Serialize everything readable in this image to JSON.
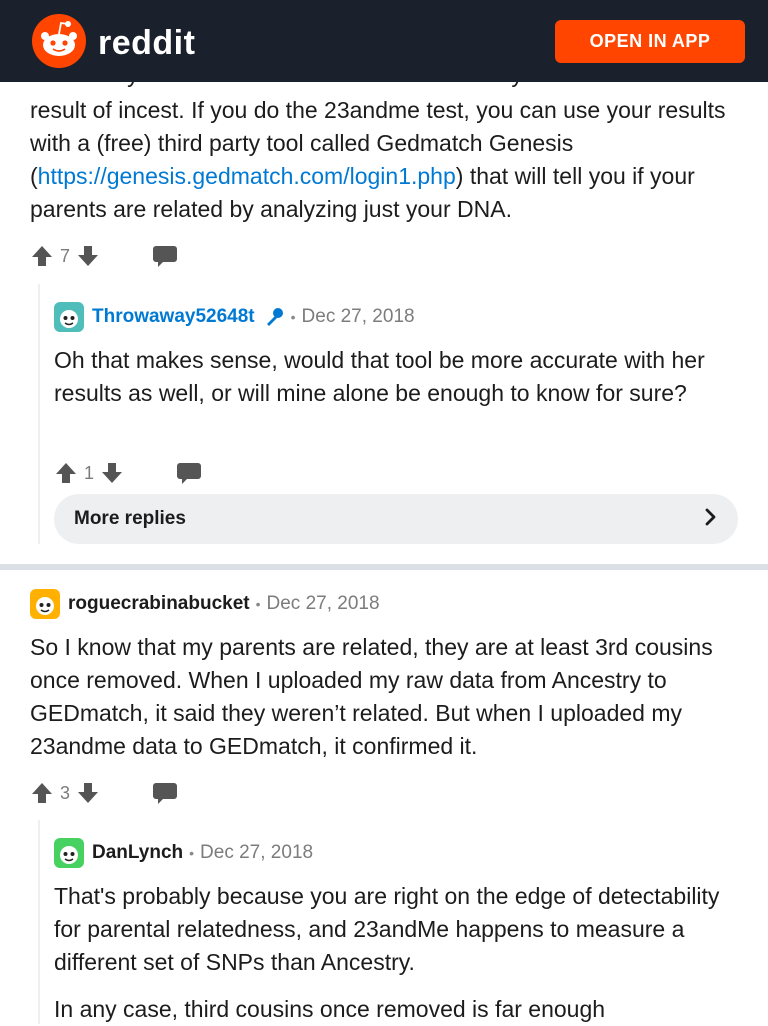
{
  "header": {
    "brand": "reddit",
    "open_app_label": "OPEN IN APP"
  },
  "colors": {
    "brand_orange": "#ff4500",
    "header_bg": "#1a202c",
    "link_blue": "#0079d3",
    "op_blue": "#0079d3"
  },
  "comments": [
    {
      "clipped_top": "However you don't need to do that to find out if you're the",
      "text_before_link": "result of incest. If you do the 23andme test, you can use your results with a (free) third party tool called Gedmatch Genesis (",
      "link": "https://genesis.gedmatch.com/login1.php",
      "text_after_link": ") that will tell you if your parents are related by analyzing just your DNA.",
      "votes": "7"
    },
    {
      "author": "Throwaway52648t",
      "date": "Dec 27, 2018",
      "text": "Oh that makes sense, would that tool be more accurate with her results as well, or will mine alone be enough to know for sure?",
      "votes": "1",
      "more_replies": "More replies"
    },
    {
      "author": "roguecrabinabucket",
      "date": "Dec 27, 2018",
      "text": "So I know that my parents are related, they are at least 3rd cousins once removed. When I uploaded my raw data from Ancestry to GEDmatch, it said they weren’t related. But when I uploaded my 23andme data to GEDmatch, it confirmed it.",
      "votes": "3"
    },
    {
      "author": "DanLynch",
      "date": "Dec 27, 2018",
      "text": "That's probably because you are right on the edge of detectability for parental relatedness, and 23andMe happens to measure a different set of SNPs than Ancestry.",
      "text2": "In any case, third cousins once removed is far enough"
    }
  ]
}
